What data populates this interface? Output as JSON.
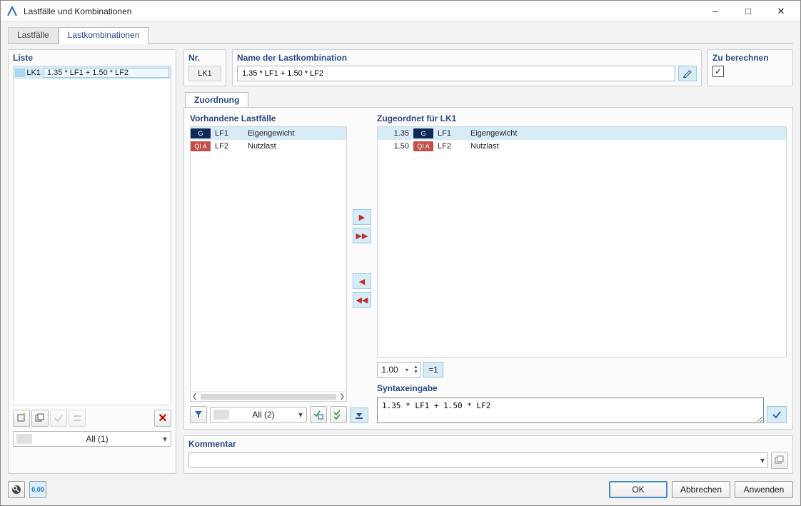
{
  "window": {
    "title": "Lastfälle und Kombinationen"
  },
  "tabs": {
    "loadcases": "Lastfälle",
    "combinations": "Lastkombinationen"
  },
  "list": {
    "title": "Liste",
    "items": [
      {
        "id": "LK1",
        "text": "1.35 * LF1 + 1.50 * LF2"
      }
    ],
    "filter_all": "All (1)"
  },
  "fields": {
    "nr_label": "Nr.",
    "nr_value": "LK1",
    "name_label": "Name der Lastkombination",
    "name_value": "1.35 * LF1 + 1.50 * LF2",
    "calc_label": "Zu berechnen",
    "calc_checked": true
  },
  "assignment": {
    "tab": "Zuordnung",
    "available_label": "Vorhandene Lastfälle",
    "assigned_label": "Zugeordnet für LK1",
    "available": [
      {
        "cat": "G",
        "catClass": "g",
        "id": "LF1",
        "desc": "Eigengewicht"
      },
      {
        "cat": "QI A",
        "catClass": "q",
        "id": "LF2",
        "desc": "Nutzlast"
      }
    ],
    "assigned": [
      {
        "factor": "1.35",
        "cat": "G",
        "catClass": "g",
        "id": "LF1",
        "desc": "Eigengewicht"
      },
      {
        "factor": "1.50",
        "cat": "QI A",
        "catClass": "q",
        "id": "LF2",
        "desc": "Nutzlast"
      }
    ],
    "factor_value": "1.00",
    "eq_label": "=1",
    "available_filter": "All (2)",
    "syntax_label": "Syntaxeingabe",
    "syntax_value": "1.35 * LF1 + 1.50 * LF2"
  },
  "comment": {
    "label": "Kommentar",
    "value": ""
  },
  "buttons": {
    "ok": "OK",
    "cancel": "Abbrechen",
    "apply": "Anwenden"
  },
  "toolbar_badge": "0,00"
}
